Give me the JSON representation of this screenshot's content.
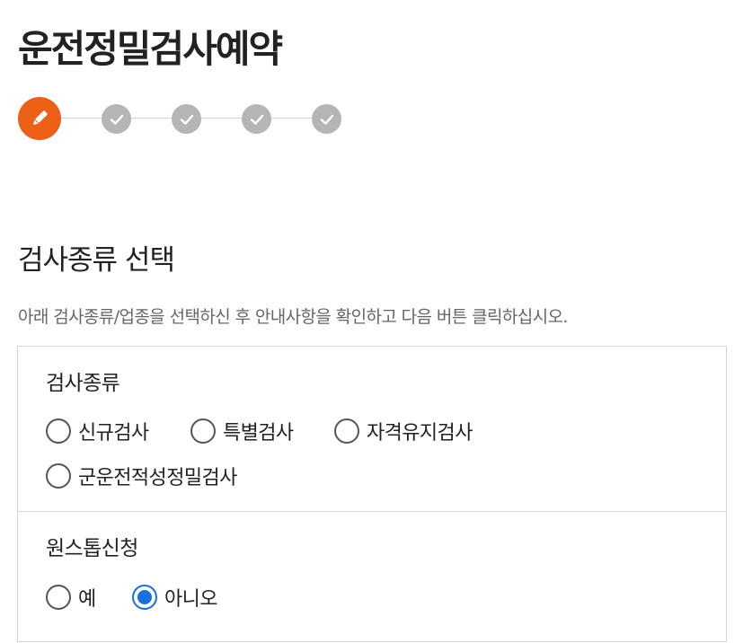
{
  "page": {
    "title": "운전정밀검사예약"
  },
  "stepper": {
    "active_step": 1,
    "total_steps": 5,
    "active_color": "#ec5f16",
    "done_color": "#b5b5b5",
    "steps": [
      {
        "state": "current",
        "icon": "pencil-icon"
      },
      {
        "state": "pending",
        "icon": "check-icon"
      },
      {
        "state": "pending",
        "icon": "check-icon"
      },
      {
        "state": "pending",
        "icon": "check-icon"
      },
      {
        "state": "pending",
        "icon": "check-icon"
      }
    ]
  },
  "section": {
    "title": "검사종류 선택",
    "description": "아래 검사종류/업종을 선택하신 후 안내사항을 확인하고 다음 버튼 클릭하십시오."
  },
  "form": {
    "inspection_type": {
      "label": "검사종류",
      "options": [
        {
          "label": "신규검사",
          "checked": false
        },
        {
          "label": "특별검사",
          "checked": false
        },
        {
          "label": "자격유지검사",
          "checked": false
        },
        {
          "label": "군운전적성정밀검사",
          "checked": false
        }
      ]
    },
    "one_stop": {
      "label": "원스톱신청",
      "options": [
        {
          "label": "예",
          "checked": false
        },
        {
          "label": "아니오",
          "checked": true
        }
      ]
    }
  },
  "colors": {
    "radio_selected": "#1a6fe0",
    "border": "#d5d5d5"
  }
}
